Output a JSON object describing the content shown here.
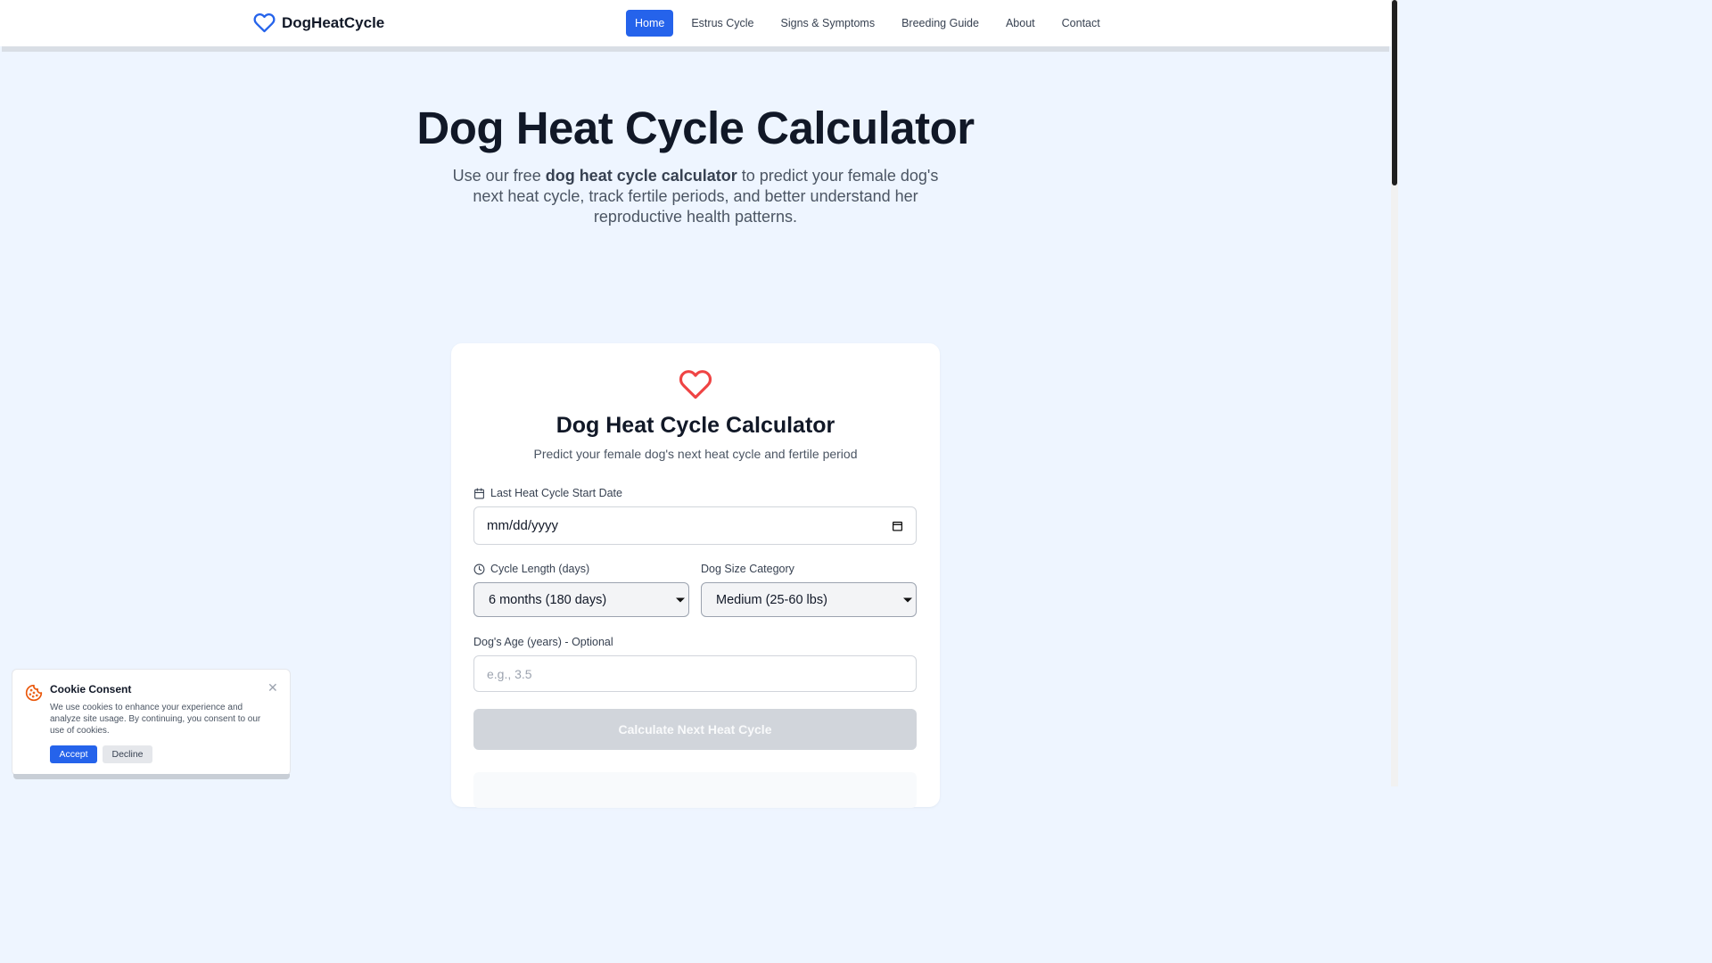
{
  "brand": {
    "name": "DogHeatCycle",
    "logo_icon": "heart-icon",
    "accent": "#2563eb"
  },
  "nav": {
    "items": [
      {
        "label": "Home",
        "active": true
      },
      {
        "label": "Estrus Cycle",
        "active": false
      },
      {
        "label": "Signs & Symptoms",
        "active": false
      },
      {
        "label": "Breeding Guide",
        "active": false
      },
      {
        "label": "About",
        "active": false
      },
      {
        "label": "Contact",
        "active": false
      }
    ]
  },
  "hero": {
    "title": "Dog Heat Cycle Calculator",
    "subtitle_before": "Use our free ",
    "subtitle_bold": "dog heat cycle calculator",
    "subtitle_after": " to predict your female dog's next heat cycle, track fertile periods, and better understand her reproductive health patterns."
  },
  "calculator": {
    "icon": "heart-icon",
    "icon_color": "#ef4444",
    "title": "Dog Heat Cycle Calculator",
    "subtitle": "Predict your female dog's next heat cycle and fertile period",
    "date_label": "Last Heat Cycle Start Date",
    "date_placeholder": "mm/dd/yyyy",
    "cycle_label": "Cycle Length (days)",
    "cycle_value": "6 months (180 days)",
    "size_label": "Dog Size Category",
    "size_value": "Medium (25-60 lbs)",
    "age_label": "Dog's Age (years) - Optional",
    "age_placeholder": "e.g., 3.5",
    "button_label": "Calculate Next Heat Cycle"
  },
  "cookie": {
    "icon": "cookie-icon",
    "title": "Cookie Consent",
    "text": "We use cookies to enhance your experience and analyze site usage. By continuing, you consent to our use of cookies.",
    "accept_label": "Accept",
    "decline_label": "Decline",
    "close_glyph": "✕"
  }
}
